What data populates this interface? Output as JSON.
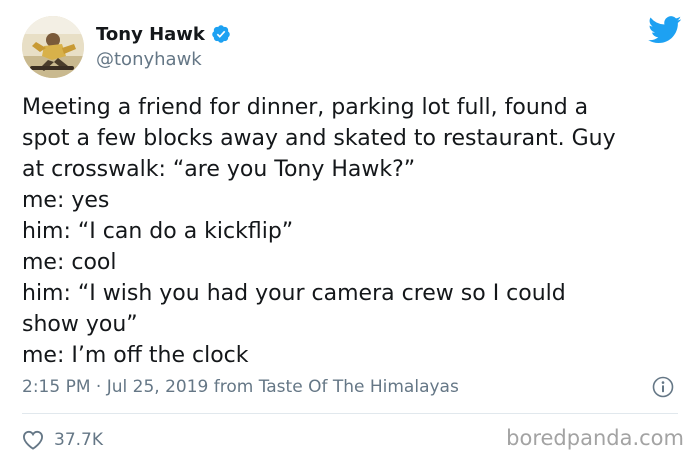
{
  "tweet": {
    "author": {
      "display_name": "Tony Hawk",
      "handle": "@tonyhawk",
      "verified": true,
      "avatar_icon": "skater-photo-avatar"
    },
    "text_lines": [
      "Meeting a friend for dinner, parking lot full, found a",
      "spot a few blocks away and skated to restaurant. Guy",
      "at crosswalk: “are you Tony Hawk?”",
      "me: yes",
      "him: “I can do a kickflip”",
      "me: cool",
      "him: “I wish you had your camera crew so I could",
      "show you”",
      "me: I’m off the clock"
    ],
    "meta": "2:15 PM · Jul 25, 2019 from Taste Of The Himalayas",
    "likes": "37.7K"
  },
  "branding": {
    "platform_icon": "twitter-bird-icon",
    "watermark": "boredpanda.com"
  },
  "colors": {
    "accent": "#1da1f2",
    "text": "#14171a",
    "muted": "#657786",
    "divider": "#e1e8ed",
    "watermark": "#a3a3a3"
  }
}
